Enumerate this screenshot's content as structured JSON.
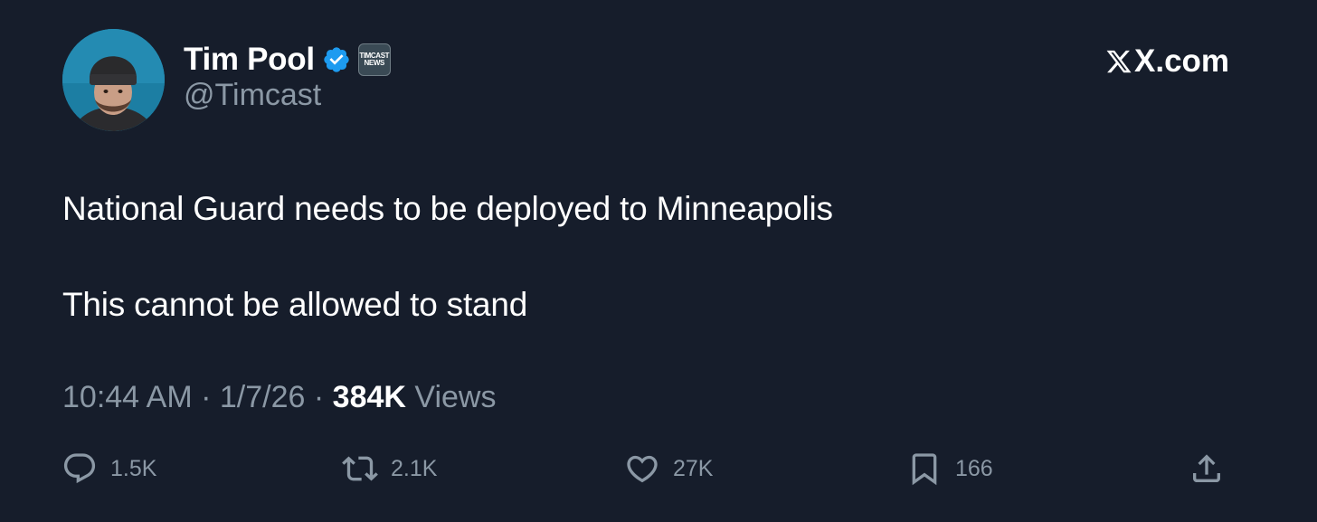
{
  "author": {
    "name": "Tim Pool",
    "handle": "@Timcast",
    "affiliate_badge": [
      "TIMCAST",
      "NEWS"
    ],
    "verified_icon": "verified-badge-icon"
  },
  "brand": {
    "label": "X.com"
  },
  "tweet": {
    "lines": [
      "National Guard needs to be deployed to Minneapolis",
      "This cannot be allowed to stand"
    ]
  },
  "meta": {
    "time": "10:44 AM",
    "separator": "·",
    "date": "1/7/26",
    "views_count": "384K",
    "views_label": "Views"
  },
  "actions": {
    "reply": {
      "icon": "reply-icon",
      "count": "1.5K"
    },
    "retweet": {
      "icon": "retweet-icon",
      "count": "2.1K"
    },
    "like": {
      "icon": "heart-icon",
      "count": "27K"
    },
    "bookmark": {
      "icon": "bookmark-icon",
      "count": "166"
    },
    "share": {
      "icon": "share-icon"
    }
  },
  "colors": {
    "background": "#161d2b",
    "text_primary": "#ffffff",
    "text_secondary": "#8b98a5",
    "verified_blue": "#1d9bf0"
  }
}
